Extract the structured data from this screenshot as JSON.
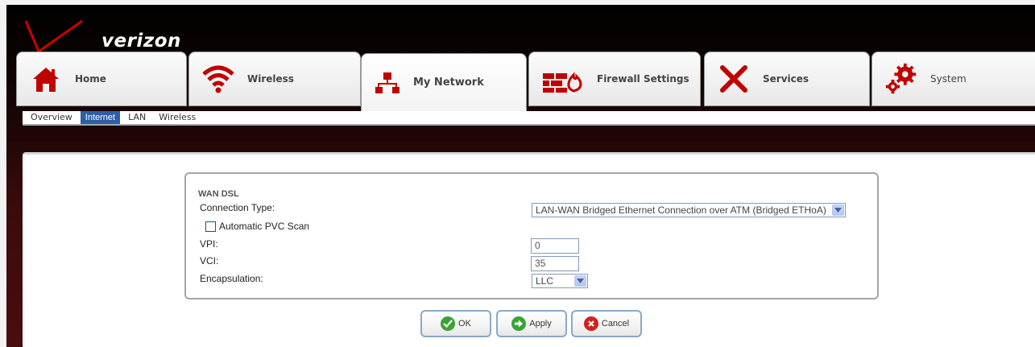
{
  "brand": {
    "logo_text": "verizon"
  },
  "tabs": [
    {
      "label": "Home",
      "icon": "home-icon"
    },
    {
      "label": "Wireless",
      "icon": "wireless-icon"
    },
    {
      "label": "My Network",
      "icon": "network-icon"
    },
    {
      "label": "Firewall Settings",
      "icon": "firewall-icon"
    },
    {
      "label": "Services",
      "icon": "services-icon"
    },
    {
      "label": "System",
      "icon": "system-icon"
    }
  ],
  "active_tab": "My Network",
  "subnav": [
    {
      "label": "Overview"
    },
    {
      "label": "Internet",
      "active": true
    },
    {
      "label": "LAN"
    },
    {
      "label": "Wireless"
    }
  ],
  "form": {
    "title": "WAN DSL",
    "connection_type_label": "Connection Type:",
    "connection_type_value": "LAN-WAN Bridged Ethernet Connection over ATM (Bridged ETHoA)",
    "auto_pvc_label": "Automatic PVC Scan",
    "auto_pvc_checked": false,
    "vpi_label": "VPI:",
    "vpi_value": "0",
    "vci_label": "VCI:",
    "vci_value": "35",
    "encapsulation_label": "Encapsulation:",
    "encapsulation_value": "LLC"
  },
  "buttons": {
    "ok": "OK",
    "apply": "Apply",
    "cancel": "Cancel"
  },
  "colors": {
    "brand_red": "#cd0000",
    "tab_icon_red": "#c00000",
    "active_subnav": "#2c5fa5",
    "ok_green": "#3aa335",
    "cancel_red": "#d32020"
  }
}
